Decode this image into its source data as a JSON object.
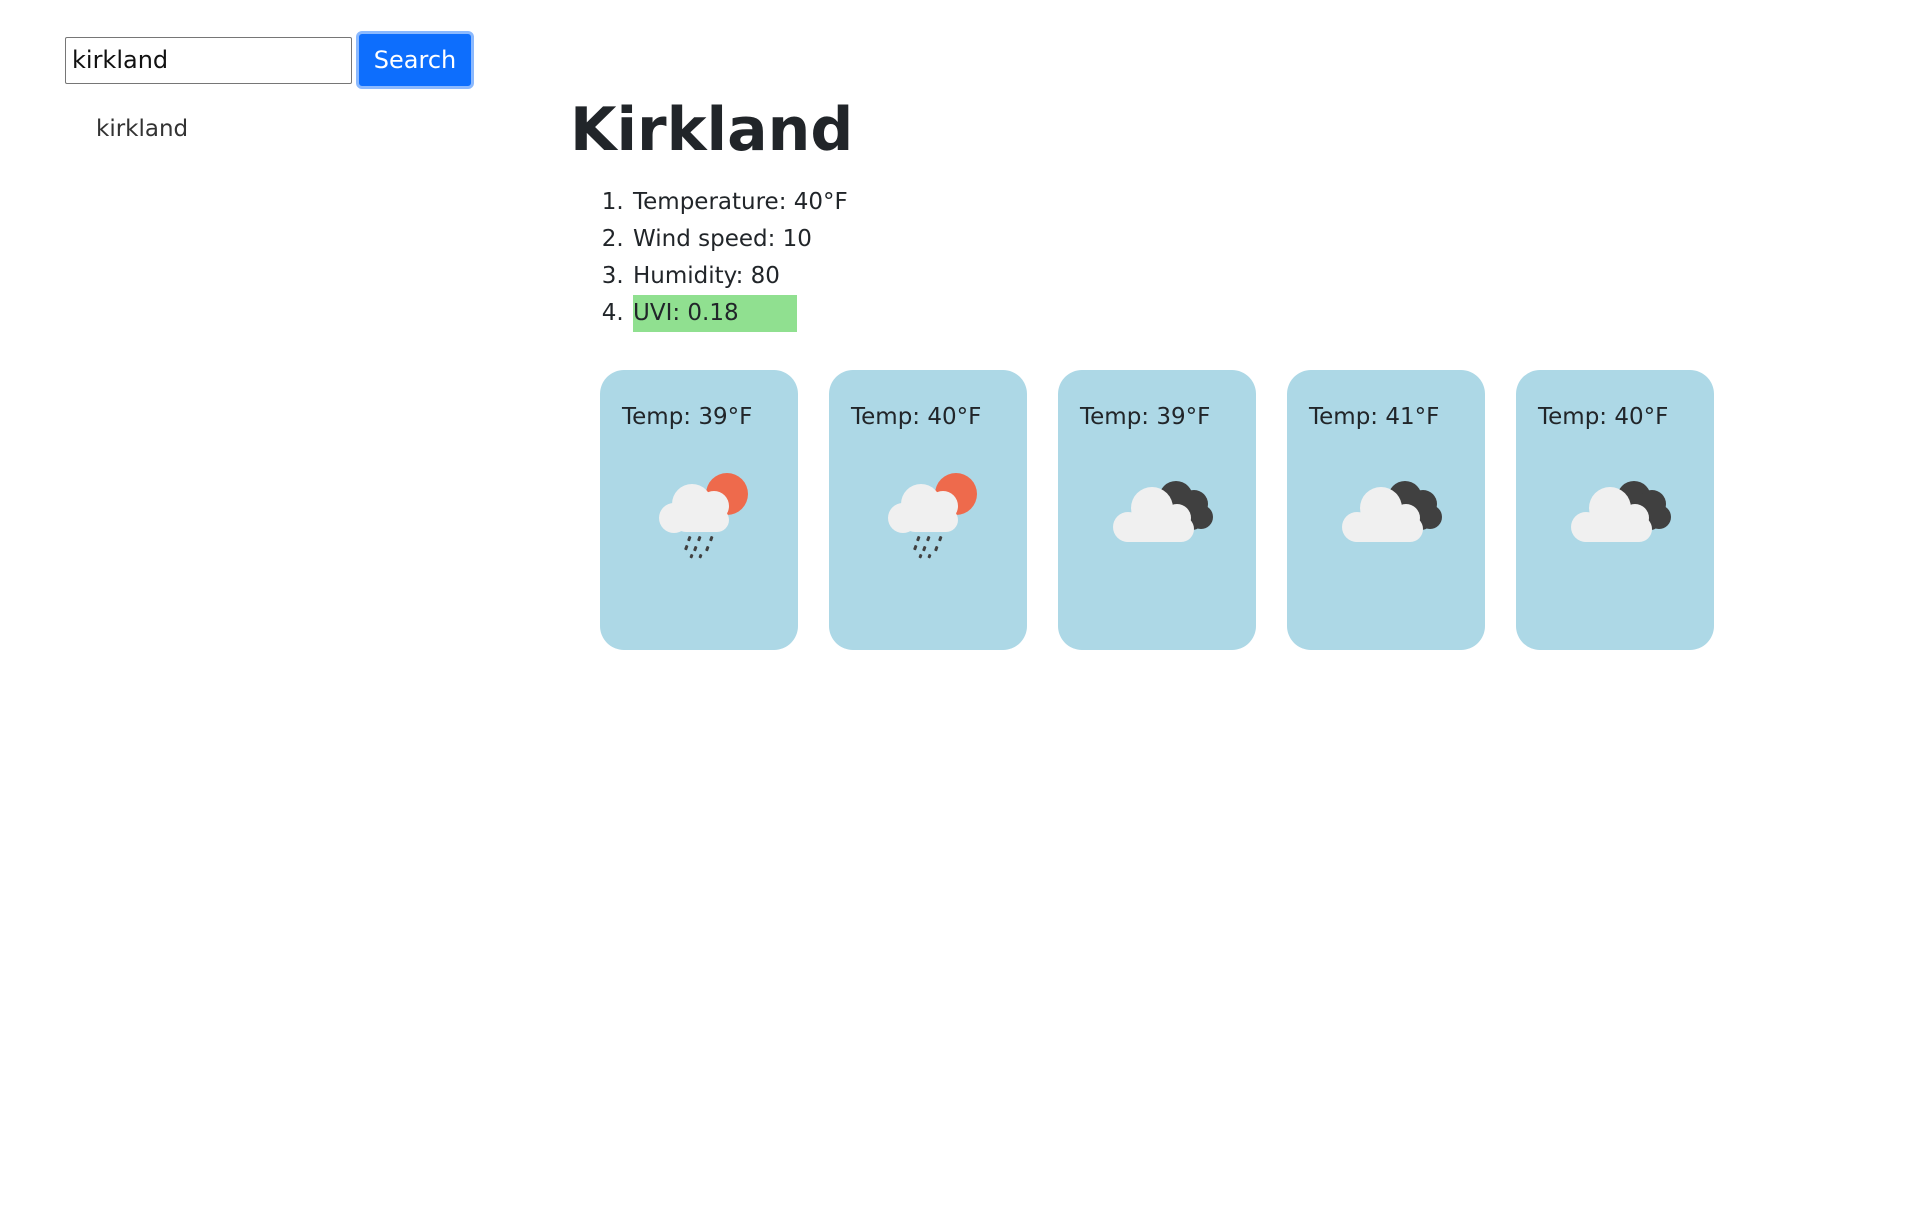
{
  "search": {
    "value": "kirkland",
    "button_label": "Search"
  },
  "history": [
    "kirkland"
  ],
  "current": {
    "city": "Kirkland",
    "stats": [
      "Temperature: 40°F",
      "Wind speed: 10",
      "Humidity: 80",
      "UVI: 0.18"
    ],
    "uvi_color": "#90e090"
  },
  "forecast": [
    {
      "temp": "Temp: 39°F",
      "icon": "rain-sun-icon"
    },
    {
      "temp": "Temp: 40°F",
      "icon": "rain-sun-icon"
    },
    {
      "temp": "Temp: 39°F",
      "icon": "cloudy-icon"
    },
    {
      "temp": "Temp: 41°F",
      "icon": "cloudy-icon"
    },
    {
      "temp": "Temp: 40°F",
      "icon": "cloudy-icon"
    }
  ],
  "colors": {
    "card_background": "#add8e6",
    "button_primary": "#0d6efd",
    "sun": "#ee6a4c",
    "dark_cloud": "#404040",
    "light_cloud": "#f0f0f0"
  }
}
